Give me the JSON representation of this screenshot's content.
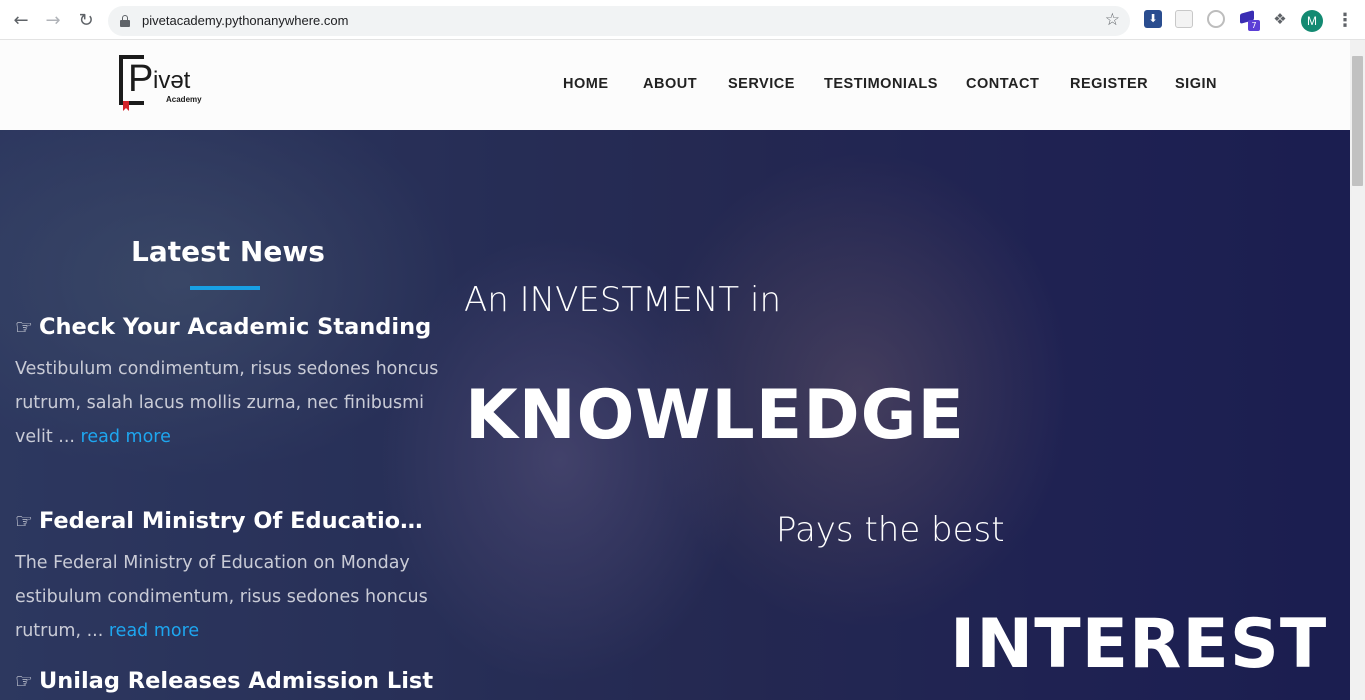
{
  "browser": {
    "url": "pivetacademy.pythonanywhere.com",
    "back_icon": "back-arrow-icon",
    "forward_icon": "forward-arrow-icon",
    "reload_icon": "reload-icon",
    "extension_badge": "7",
    "avatar_letter": "M"
  },
  "site": {
    "logo": {
      "letter": "P",
      "word": "ivət",
      "sub": "Academy"
    },
    "nav": [
      "HOME",
      "ABOUT",
      "SERVICE",
      "TESTIMONIALS",
      "CONTACT",
      "REGISTER",
      "SIGIN"
    ]
  },
  "news": {
    "title": "Latest News",
    "items": [
      {
        "title": "Check Your Academic Standing",
        "body": "Vestibulum condimentum, risus sedones honcus rutrum, salah lacus mollis zurna, nec finibusmi velit ...",
        "link": "read more"
      },
      {
        "title": "Federal Ministry Of Education...",
        "body": "The Federal Ministry of Education on Monday estibulum condimentum, risus sedones honcus rutrum, ...",
        "link": "read more"
      },
      {
        "title": "Unilag Releases Admission List",
        "body": "",
        "link": ""
      }
    ]
  },
  "hero": {
    "line1": "An INVESTMENT in",
    "line2": "KNOWLEDGE",
    "line3": "Pays the best",
    "line4": "INTEREST"
  },
  "colors": {
    "accent": "#18a0e4",
    "link": "#1ea6ef",
    "hero_overlay": "#2d3258",
    "avatar": "#138a72"
  }
}
